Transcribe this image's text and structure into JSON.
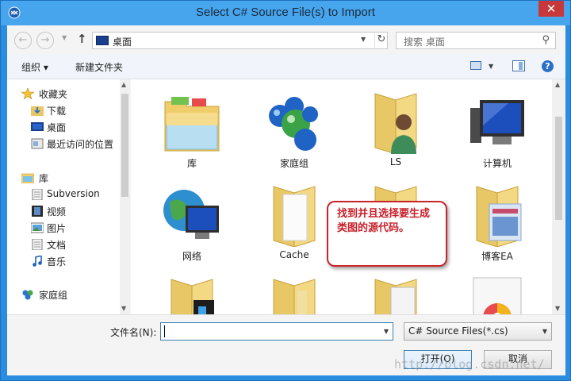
{
  "window": {
    "title": "Select C# Source File(s) to Import",
    "close_label": "✕"
  },
  "nav_buttons": {
    "back": "←",
    "forward": "→",
    "up": "↑"
  },
  "address": {
    "path": "桌面"
  },
  "search": {
    "placeholder": "搜索 桌面"
  },
  "toolbar": {
    "organize_label": "组织 ▾",
    "new_folder_label": "新建文件夹",
    "help_label": "?"
  },
  "sidebar": {
    "items": [
      {
        "label": "收藏夹",
        "icon": "star-icon"
      },
      {
        "label": "下载",
        "icon": "download-folder-icon"
      },
      {
        "label": "桌面",
        "icon": "desktop-icon"
      },
      {
        "label": "最近访问的位置",
        "icon": "recent-places-icon"
      },
      {
        "label": "库",
        "icon": "library-icon"
      },
      {
        "label": "Subversion",
        "icon": "document-icon"
      },
      {
        "label": "视频",
        "icon": "video-icon"
      },
      {
        "label": "图片",
        "icon": "picture-icon"
      },
      {
        "label": "文档",
        "icon": "document-icon"
      },
      {
        "label": "音乐",
        "icon": "music-icon"
      },
      {
        "label": "家庭组",
        "icon": "homegroup-icon"
      }
    ]
  },
  "files": [
    {
      "label": "库",
      "icon": "library-folder-icon"
    },
    {
      "label": "家庭组",
      "icon": "homegroup-icon"
    },
    {
      "label": "LS",
      "icon": "user-folder-icon"
    },
    {
      "label": "计算机",
      "icon": "computer-icon"
    },
    {
      "label": "网络",
      "icon": "network-icon"
    },
    {
      "label": "Cache",
      "icon": "folder-icon"
    },
    {
      "label": "",
      "icon": "folder-icon"
    },
    {
      "label": "博客EA",
      "icon": "folder-icon"
    },
    {
      "label": "",
      "icon": "folder-icon"
    },
    {
      "label": "",
      "icon": "folder-icon"
    },
    {
      "label": "",
      "icon": "folder-icon"
    },
    {
      "label": "",
      "icon": "file-icon"
    }
  ],
  "callout": {
    "text": "找到并且选择要生成类图的源代码。"
  },
  "footer": {
    "filename_label": "文件名(N):",
    "filename_value": "",
    "filter_value": "C# Source Files(*.cs)",
    "open_label": "打开(O)",
    "cancel_label": "取消"
  },
  "watermark": "http://blog.csdn.net/",
  "colors": {
    "title_bar": "#47a5ee",
    "window_border": "#2b8de0",
    "callout_border": "#c7252b",
    "callout_text": "#c8202a"
  }
}
